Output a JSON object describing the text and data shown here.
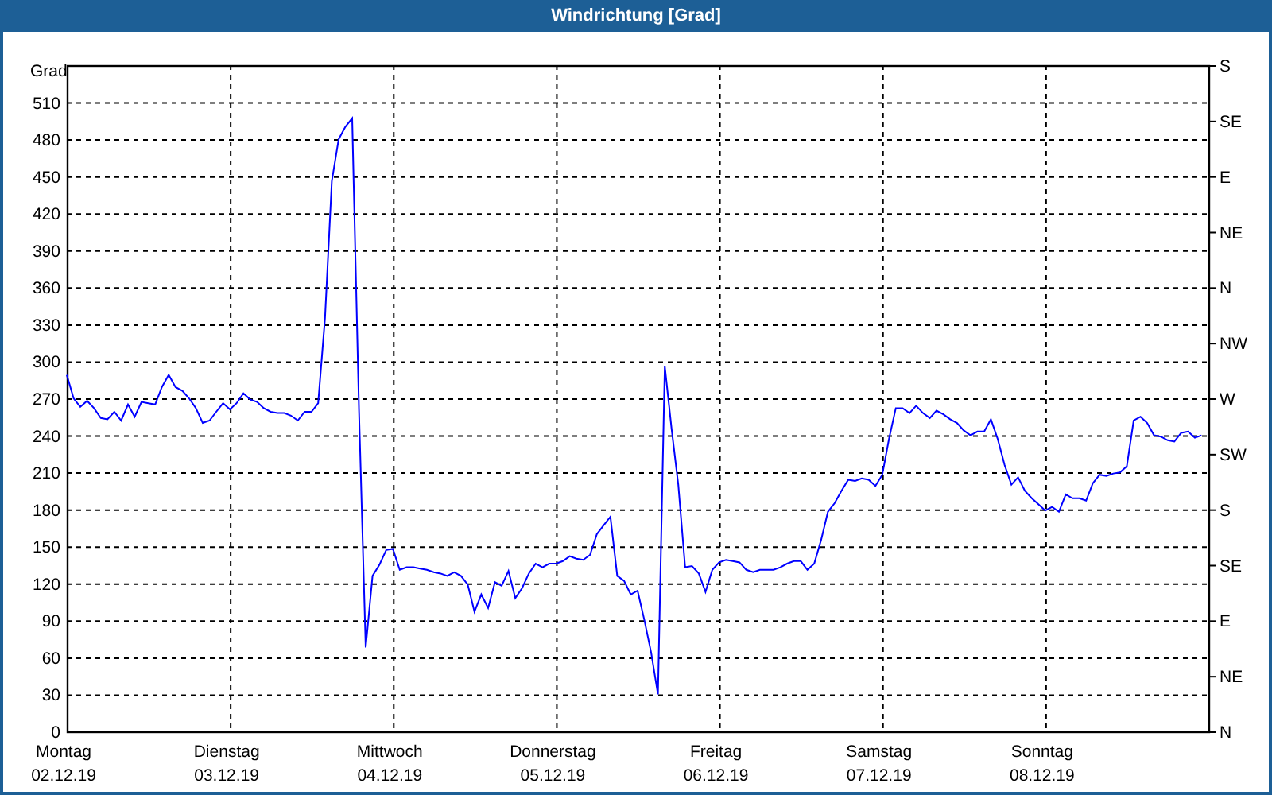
{
  "chart": {
    "chart_data": {
      "type": "line",
      "title": "Windrichtung [Grad]",
      "ylabel": "Grad",
      "grid": true,
      "ylim": [
        0,
        540
      ],
      "categories": [
        "Montag 02.12.19",
        null,
        null,
        null,
        null,
        null,
        null,
        null,
        null,
        null,
        null,
        null,
        null,
        null,
        null,
        null,
        null,
        null,
        null,
        null,
        null,
        null,
        null,
        null,
        "Dienstag 03.12.19",
        null,
        null,
        null,
        null,
        null,
        null,
        null,
        null,
        null,
        null,
        null,
        null,
        null,
        null,
        null,
        null,
        null,
        null,
        null,
        null,
        null,
        null,
        null,
        "Mittwoch 04.12.19",
        null,
        null,
        null,
        null,
        null,
        null,
        null,
        null,
        null,
        null,
        null,
        null,
        null,
        null,
        null,
        null,
        null,
        null,
        null,
        null,
        null,
        null,
        null,
        "Donnerstag 05.12.19",
        null,
        null,
        null,
        null,
        null,
        null,
        null,
        null,
        null,
        null,
        null,
        null,
        null,
        null,
        null,
        null,
        null,
        null,
        null,
        null,
        null,
        null,
        null,
        "Freitag 06.12.19",
        null,
        null,
        null,
        null,
        null,
        null,
        null,
        null,
        null,
        null,
        null,
        null,
        null,
        null,
        null,
        null,
        null,
        null,
        null,
        null,
        null,
        null,
        null,
        "Samstag 07.12.19",
        null,
        null,
        null,
        null,
        null,
        null,
        null,
        null,
        null,
        null,
        null,
        null,
        null,
        null,
        null,
        null,
        null,
        null,
        null,
        null,
        null,
        null,
        null,
        "Sonntag 08.12.19",
        null,
        null,
        null,
        null,
        null,
        null,
        null,
        null,
        null,
        null,
        null,
        null,
        null,
        null,
        null,
        null,
        null,
        null,
        null,
        null,
        null,
        null,
        null
      ],
      "yticks": [
        0,
        30,
        60,
        90,
        120,
        150,
        180,
        210,
        240,
        270,
        300,
        330,
        360,
        390,
        420,
        450,
        480,
        510
      ],
      "series": [
        {
          "color": "#0000ff",
          "values": [
            289,
            270,
            263,
            268,
            262,
            254,
            253,
            259,
            252,
            265,
            255,
            267,
            266,
            265,
            279,
            289,
            279,
            276,
            270,
            262,
            250,
            252,
            259,
            266,
            261,
            266,
            274,
            269,
            267,
            262,
            259,
            258,
            258,
            256,
            252,
            259,
            259,
            266,
            335,
            446,
            480,
            490,
            497,
            260,
            68,
            126,
            135,
            147,
            148,
            131,
            133,
            133,
            132,
            131,
            129,
            128,
            126,
            129,
            126,
            119,
            97,
            111,
            100,
            121,
            118,
            130,
            108,
            116,
            128,
            136,
            133,
            136,
            136,
            138,
            142,
            140,
            139,
            143,
            160,
            167,
            174,
            126,
            122,
            111,
            114,
            90,
            64,
            30,
            296,
            245,
            200,
            133,
            134,
            128,
            113,
            131,
            137,
            139,
            138,
            137,
            131,
            129,
            131,
            131,
            131,
            133,
            136,
            138,
            138,
            131,
            136,
            155,
            178,
            185,
            195,
            204,
            203,
            205,
            204,
            199,
            208,
            237,
            262,
            262,
            258,
            264,
            258,
            254,
            260,
            257,
            253,
            250,
            244,
            240,
            243,
            243,
            253,
            237,
            216,
            200,
            206,
            195,
            189,
            184,
            179,
            182,
            178,
            192,
            189,
            189,
            187,
            201,
            208,
            207,
            209,
            210,
            215,
            252,
            255,
            250,
            240,
            239,
            236,
            235,
            242,
            243,
            238,
            240
          ]
        }
      ]
    },
    "right_axis": {
      "ticks": [
        "S",
        "SE",
        "E",
        "NE",
        "N",
        "NW",
        "W",
        "SW",
        "S",
        "SE",
        "E",
        "NE",
        "N"
      ]
    }
  }
}
